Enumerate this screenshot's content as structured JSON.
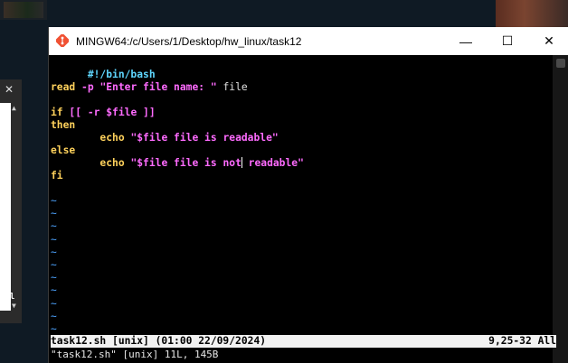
{
  "window": {
    "title": "MINGW64:/c/Users/1/Desktop/hw_linux/task12",
    "min_label": "—",
    "max_label": "☐",
    "close_label": "✕"
  },
  "background": {
    "left_close": "✕",
    "left_tag": "All"
  },
  "editor": {
    "shebang": "#!/bin/bash",
    "read_kw": "read",
    "read_flag": " -p ",
    "read_prompt": "\"Enter file name: \"",
    "read_var": " file",
    "if_kw": "if",
    "if_open": " [[ ",
    "if_test": "-r ",
    "if_var": "$file",
    "if_close": " ]]",
    "then_kw": "then",
    "echo1_indent": "        ",
    "echo1_kw": "echo",
    "echo1_str": " \"$file file is readable\"",
    "else_kw": "else",
    "echo2_kw": "echo",
    "echo2_str_a": " \"$file file is not",
    "echo2_str_b": " readable\"",
    "fi_kw": "fi",
    "tilde": "~",
    "tilde_count": 11
  },
  "statusbar": {
    "left": "task12.sh [unix] (01:00 22/09/2024)",
    "right": "9,25-32 All"
  },
  "message": "\"task12.sh\" [unix] 11L, 145B",
  "colors": {
    "keyword": "#ffd25c",
    "string": "#ff6bff",
    "comment": "#5fd7ff",
    "tilde": "#4da3ff"
  }
}
